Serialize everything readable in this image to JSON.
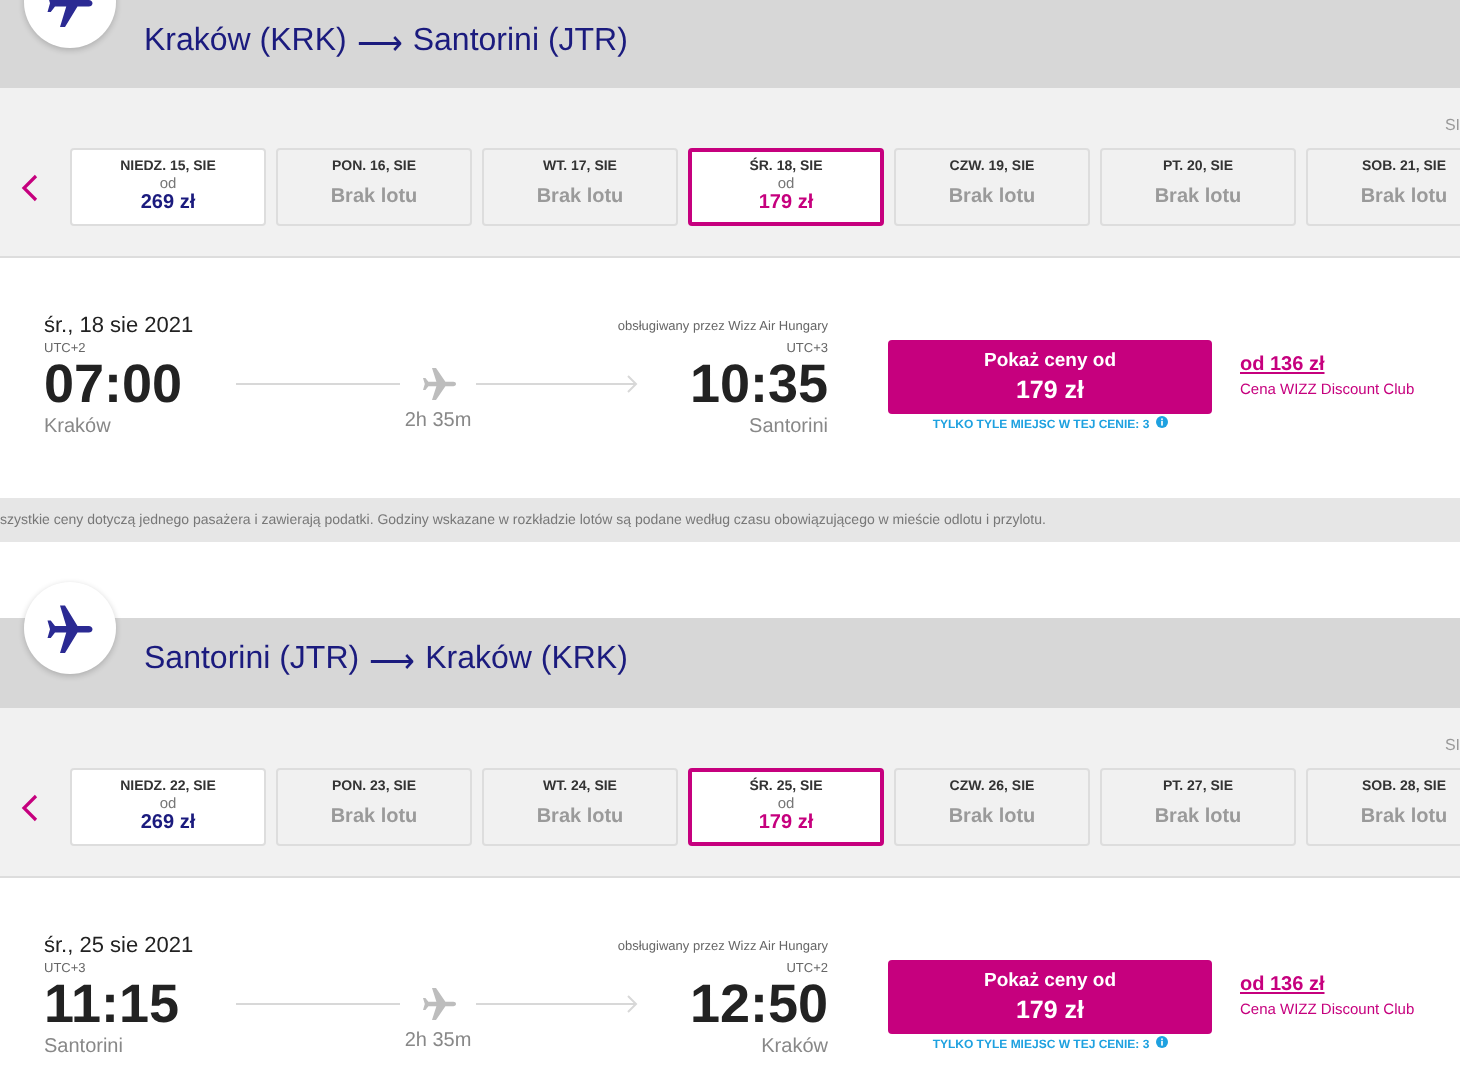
{
  "sections": [
    {
      "route": {
        "from": "Kraków (KRK)",
        "arrow": "⟶",
        "to": "Santorini (JTR)"
      },
      "month_label": "SI",
      "days": [
        {
          "day": "NIEDZ. 15, SIE",
          "kind": "price",
          "prefix": "od",
          "price": "269 zł",
          "selected": false
        },
        {
          "day": "PON. 16, SIE",
          "kind": "none",
          "note": "Brak lotu",
          "selected": false
        },
        {
          "day": "WT. 17, SIE",
          "kind": "none",
          "note": "Brak lotu",
          "selected": false
        },
        {
          "day": "ŚR. 18, SIE",
          "kind": "price",
          "prefix": "od",
          "price": "179 zł",
          "selected": true
        },
        {
          "day": "CZW. 19, SIE",
          "kind": "none",
          "note": "Brak lotu",
          "selected": false
        },
        {
          "day": "PT. 20, SIE",
          "kind": "none",
          "note": "Brak lotu",
          "selected": false
        },
        {
          "day": "SOB. 21, SIE",
          "kind": "none",
          "note": "Brak lotu",
          "selected": false
        }
      ],
      "flight": {
        "date": "śr., 18 sie 2021",
        "operator": "obsługiwany przez Wizz Air Hungary",
        "dep_utc": "UTC+2",
        "dep_time": "07:00",
        "dep_city": "Kraków",
        "duration": "2h 35m",
        "arr_utc": "UTC+3",
        "arr_time": "10:35",
        "arr_city": "Santorini",
        "button_line1": "Pokaż ceny od",
        "button_price": "179 zł",
        "seats_note": "TYLKO TYLE MIEJSC W TEJ CENIE: 3",
        "club_prefix": "od",
        "club_price": "136 zł",
        "club_label": "Cena WIZZ Discount Club"
      },
      "disclaimer": "szystkie ceny dotyczą jednego pasażera i zawierają podatki. Godziny wskazane w rozkładzie lotów są podane według czasu obowiązującego w mieście odlotu i przylotu."
    },
    {
      "route": {
        "from": "Santorini (JTR)",
        "arrow": "⟶",
        "to": "Kraków (KRK)"
      },
      "month_label": "SI",
      "days": [
        {
          "day": "NIEDZ. 22, SIE",
          "kind": "price",
          "prefix": "od",
          "price": "269 zł",
          "selected": false
        },
        {
          "day": "PON. 23, SIE",
          "kind": "none",
          "note": "Brak lotu",
          "selected": false
        },
        {
          "day": "WT. 24, SIE",
          "kind": "none",
          "note": "Brak lotu",
          "selected": false
        },
        {
          "day": "ŚR. 25, SIE",
          "kind": "price",
          "prefix": "od",
          "price": "179 zł",
          "selected": true
        },
        {
          "day": "CZW. 26, SIE",
          "kind": "none",
          "note": "Brak lotu",
          "selected": false
        },
        {
          "day": "PT. 27, SIE",
          "kind": "none",
          "note": "Brak lotu",
          "selected": false
        },
        {
          "day": "SOB. 28, SIE",
          "kind": "none",
          "note": "Brak lotu",
          "selected": false
        }
      ],
      "flight": {
        "date": "śr., 25 sie 2021",
        "operator": "obsługiwany przez Wizz Air Hungary",
        "dep_utc": "UTC+3",
        "dep_time": "11:15",
        "dep_city": "Santorini",
        "duration": "2h 35m",
        "arr_utc": "UTC+2",
        "arr_time": "12:50",
        "arr_city": "Kraków",
        "button_line1": "Pokaż ceny od",
        "button_price": "179 zł",
        "seats_note": "TYLKO TYLE MIEJSC W TEJ CENIE: 3",
        "club_prefix": "od",
        "club_price": "136 zł",
        "club_label": "Cena WIZZ Discount Club"
      }
    }
  ]
}
